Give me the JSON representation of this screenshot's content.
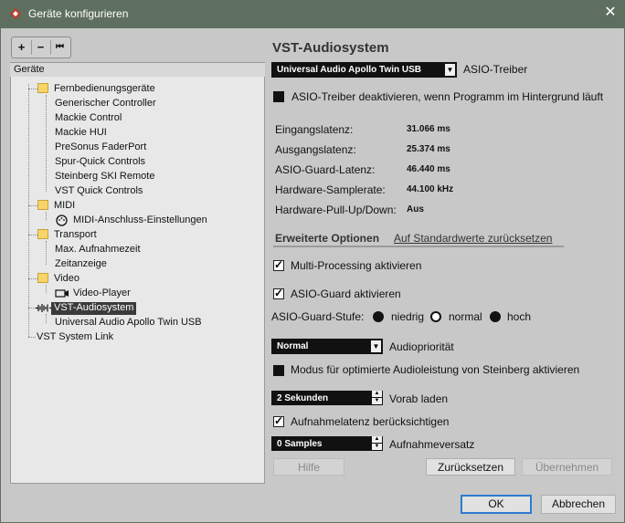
{
  "window": {
    "title": "Geräte konfigurieren"
  },
  "toolbar": {
    "add": "+",
    "remove": "−",
    "reset": "⏮"
  },
  "tree": {
    "header": "Geräte",
    "items": [
      "Fernbedienungsgeräte",
      "Generischer Controller",
      "Mackie Control",
      "Mackie HUI",
      "PreSonus FaderPort",
      "Spur-Quick Controls",
      "Steinberg SKI Remote",
      "VST Quick Controls",
      "MIDI",
      "MIDI-Anschluss-Einstellungen",
      "Transport",
      "Max. Aufnahmezeit",
      "Zeitanzeige",
      "Video",
      "Video-Player",
      "VST-Audiosystem",
      "Universal Audio Apollo Twin USB",
      "VST System Link"
    ]
  },
  "panel": {
    "title": "VST-Audiosystem",
    "driver_value": "Universal Audio Apollo Twin USB",
    "driver_label": "ASIO-Treiber",
    "deactivate_label": "ASIO-Treiber deaktivieren, wenn Programm im Hintergrund läuft",
    "info": [
      {
        "label": "Eingangslatenz:",
        "value": "31.066 ms"
      },
      {
        "label": "Ausgangslatenz:",
        "value": "25.374 ms"
      },
      {
        "label": "ASIO-Guard-Latenz:",
        "value": "46.440 ms"
      },
      {
        "label": "Hardware-Samplerate:",
        "value": "44.100 kHz"
      },
      {
        "label": "Hardware-Pull-Up/Down:",
        "value": "Aus"
      }
    ],
    "tab_advanced": "Erweiterte Optionen",
    "tab_reset_defaults": "Auf Standardwerte zurücksetzen",
    "multiprocessing_label": "Multi-Processing aktivieren",
    "asioguard_label": "ASIO-Guard aktivieren",
    "asioguard_level_label": "ASIO-Guard-Stufe:",
    "level_options": [
      "niedrig",
      "normal",
      "hoch"
    ],
    "priority_value": "Normal",
    "priority_label": "Audiopriorität",
    "steinberg_mode_label": "Modus für optimierte Audioleistung von Steinberg aktivieren",
    "preload_value": "2 Sekunden",
    "preload_label": "Vorab laden",
    "record_latency_label": "Aufnahmelatenz berücksichtigen",
    "record_shift_value": "0 Samples",
    "record_shift_label": "Aufnahmeversatz",
    "help_button": "Hilfe",
    "reset_button": "Zurücksetzen",
    "apply_button": "Übernehmen"
  },
  "footer": {
    "ok_button": "OK",
    "cancel_button": "Abbrechen"
  },
  "colors": {
    "accent": "#2d7bd0",
    "titlebar": "#5f6f5f",
    "folder": "#f7d46a"
  }
}
